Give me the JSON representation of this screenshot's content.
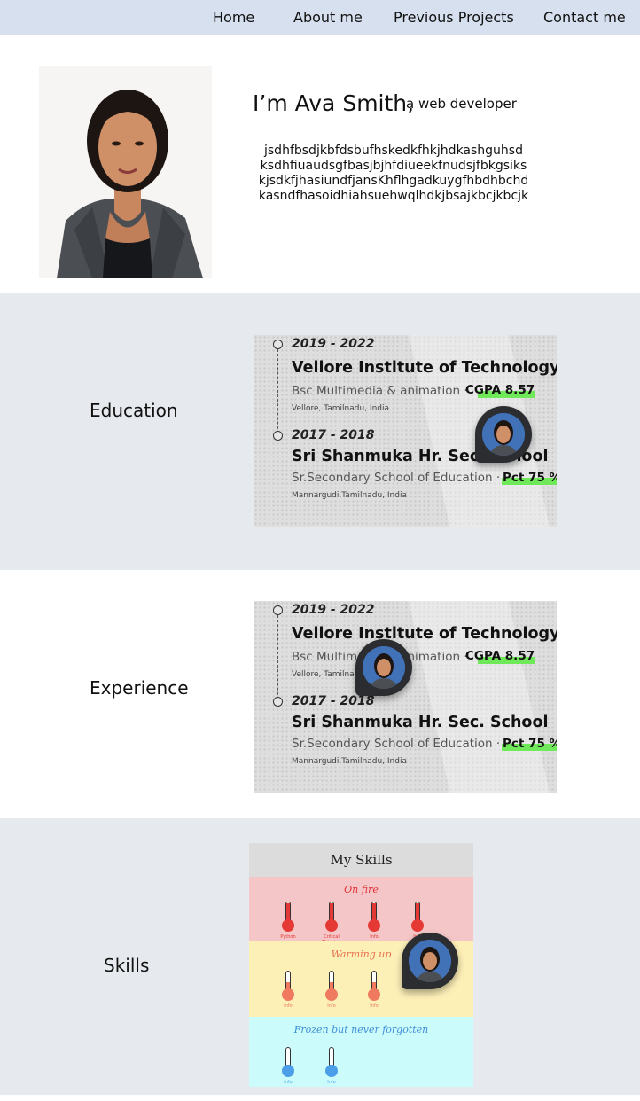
{
  "nav": {
    "items": [
      "Home",
      "About me",
      "Previous Projects",
      "Contact me"
    ]
  },
  "hero": {
    "title": "I’m Ava Smith,",
    "subtitle": "a web developer",
    "lines": [
      "jsdhfbsdjkbfdsbufhskedkfhkjhdkashguhsd",
      "ksdhfiuaudsgfbasjbjhfdiueekfnudsjfbkgsiks",
      "kjsdkfjhasiundfjansKhflhgadkuygfhbdhbchd",
      "kasndfhasoidhiahsuehwqlhdkjbsajkbcjkbcjk"
    ]
  },
  "sections": {
    "education": "Education",
    "experience": "Experience",
    "skills": "Skills"
  },
  "timeline": [
    {
      "year": "2019 - 2022",
      "school": "Vellore Institute of Technology",
      "degree": "Bsc Multimedia & animation ·",
      "grade": "CGPA 8.57",
      "location": "Vellore, Tamilnadu, India"
    },
    {
      "year": "2017 - 2018",
      "school": "Sri Shanmuka Hr. Sec. School",
      "degree": "Sr.Secondary School of Education ·",
      "grade": "Pct 75 %",
      "location": "Mannargudi,Tamilnadu, India"
    }
  ],
  "skills_card": {
    "title": "My Skills",
    "groups": [
      {
        "title": "On fire",
        "color": "#f4c6c7",
        "title_color": "#e0353a",
        "thermo_color": "#e53935",
        "fill": 1.0,
        "labels": [
          "Python",
          "Critical Thinking",
          "Info",
          "Info"
        ]
      },
      {
        "title": "Warming up",
        "color": "#fdf0b7",
        "title_color": "#e8704f",
        "thermo_color": "#ef7a5f",
        "fill": 0.5,
        "labels": [
          "Info",
          "Info",
          "Info"
        ]
      },
      {
        "title": "Frozen but never forgotten",
        "color": "#ccfbfb",
        "title_color": "#3c8fd8",
        "thermo_color": "#4d9ee8",
        "fill": 0.2,
        "labels": [
          "Info",
          "Info"
        ]
      }
    ]
  },
  "colors": {
    "nav_bg": "#d6e0ef",
    "band_bg": "#e6e9ed",
    "highlight": "#6fe85a"
  }
}
